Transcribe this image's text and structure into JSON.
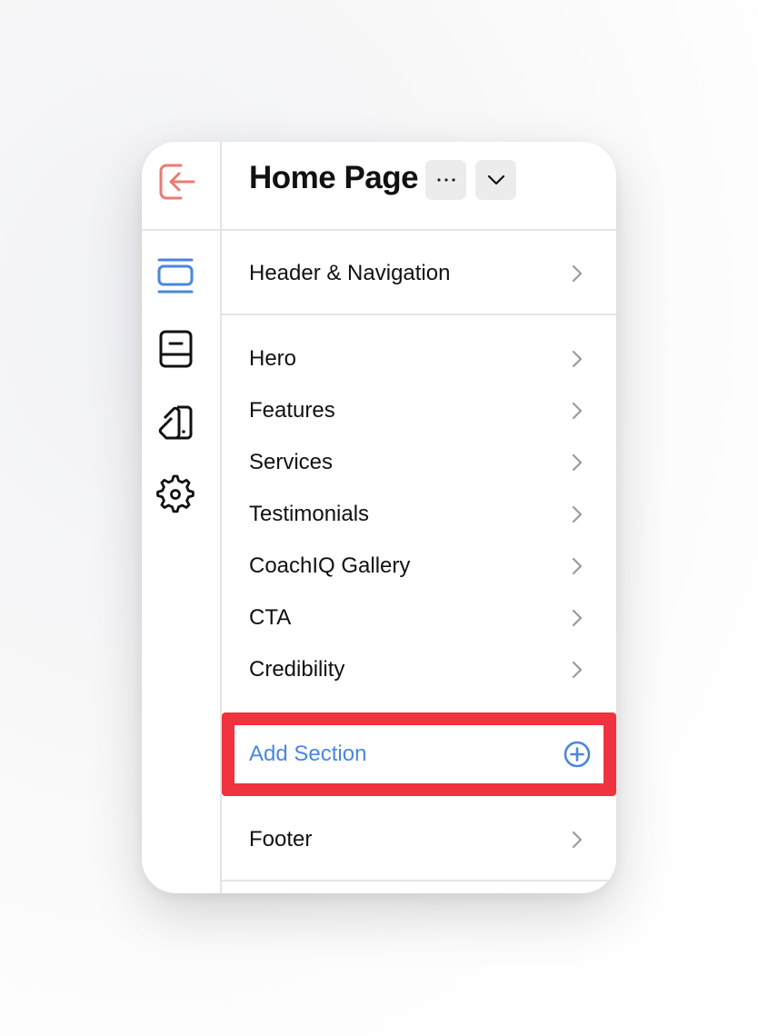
{
  "page_title": "Home Page",
  "header_more_icon": "more-horizontal-icon",
  "header_dropdown_icon": "chevron-down-icon",
  "rail": {
    "exit_icon": "exit-arrow-icon",
    "items": [
      {
        "icon": "sections-icon",
        "active": true
      },
      {
        "icon": "pages-book-icon",
        "active": false
      },
      {
        "icon": "theme-swatch-icon",
        "active": false
      },
      {
        "icon": "settings-gear-icon",
        "active": false
      }
    ]
  },
  "top_section": {
    "label": "Header & Navigation"
  },
  "sections": [
    {
      "label": "Hero"
    },
    {
      "label": "Features"
    },
    {
      "label": "Services"
    },
    {
      "label": "Testimonials"
    },
    {
      "label": "CoachIQ Gallery"
    },
    {
      "label": "CTA"
    },
    {
      "label": "Credibility"
    }
  ],
  "add_section": {
    "label": "Add Section",
    "icon": "plus-circle-icon"
  },
  "footer_section": {
    "label": "Footer"
  },
  "colors": {
    "accent_blue": "#4a86e0",
    "exit_icon": "#ec7a74",
    "highlight_red": "#f1323f"
  }
}
